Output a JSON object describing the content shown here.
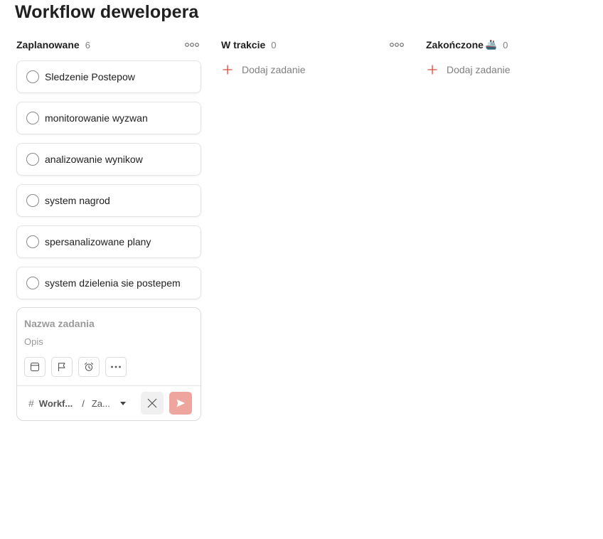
{
  "page": {
    "title": "Workflow dewelopera"
  },
  "columns": [
    {
      "name": "Zaplanowane",
      "count": "6",
      "menu_icon": "more-horizontal-icon",
      "tasks": [
        "Sledzenie Postepow",
        "monitorowanie wyzwan",
        "analizowanie wynikow",
        "system nagrod",
        "spersanalizowane plany",
        "system dzielenia sie postepem"
      ]
    },
    {
      "name": "W trakcie",
      "count": "0",
      "menu_icon": "more-horizontal-icon",
      "add_label": "Dodaj zadanie"
    },
    {
      "name": "Zakończone",
      "emoji": "🚢",
      "count": "0",
      "menu_icon": "more-horizontal-icon",
      "add_label": "Dodaj zadanie"
    }
  ],
  "editor": {
    "name_placeholder": "Nazwa zadania",
    "description_placeholder": "Opis",
    "tools": [
      "calendar-icon",
      "flag-icon",
      "alarm-clock-icon",
      "more-horizontal-icon"
    ],
    "project": "Workf...",
    "separator": "/",
    "section": "Za...",
    "cancel_icon": "close-icon",
    "submit_icon": "send-icon"
  },
  "colors": {
    "accent": "#dc4c3e",
    "submit_disabled": "#eda59e",
    "text": "#202020",
    "muted": "#808080",
    "border": "#e4e4e4"
  }
}
